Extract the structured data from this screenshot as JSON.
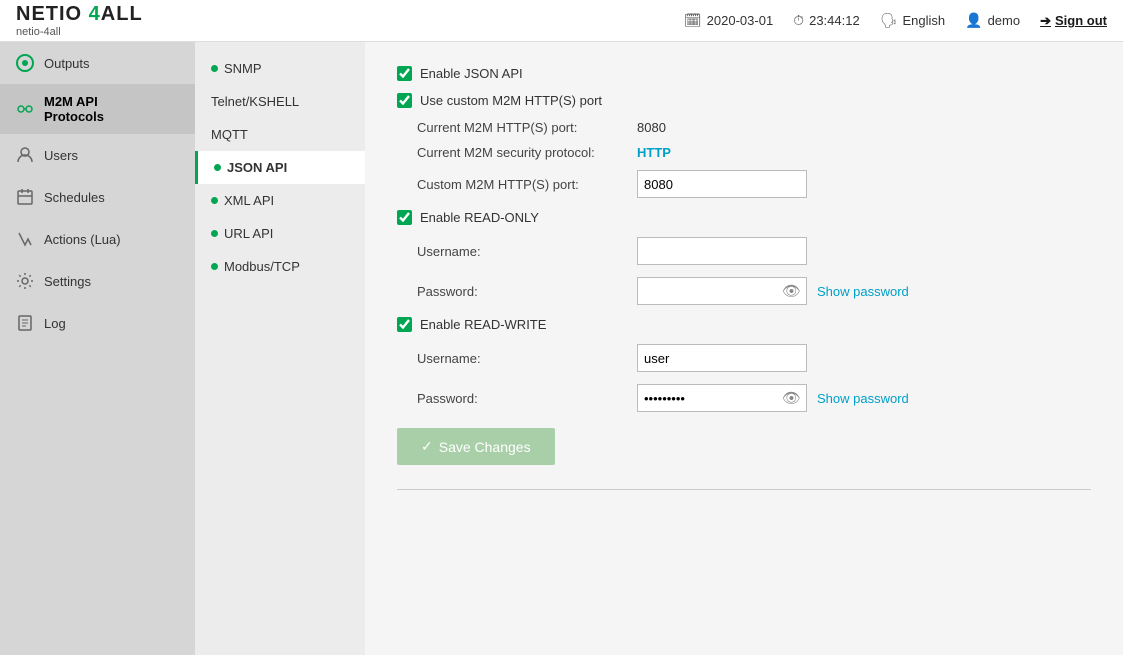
{
  "topbar": {
    "logo": "NETIO 4ALL",
    "subtitle": "netio-4all",
    "date": "2020-03-01",
    "time": "23:44:12",
    "language": "English",
    "user": "demo",
    "signout_label": "Sign out"
  },
  "sidebar": {
    "items": [
      {
        "id": "outputs",
        "label": "Outputs",
        "icon": "outputs-icon"
      },
      {
        "id": "m2m-api",
        "label": "M2M API\nProtocols",
        "label_line1": "M2M API",
        "label_line2": "Protocols",
        "icon": "m2m-icon",
        "active": true
      },
      {
        "id": "users",
        "label": "Users",
        "icon": "users-icon"
      },
      {
        "id": "schedules",
        "label": "Schedules",
        "icon": "schedules-icon"
      },
      {
        "id": "actions",
        "label": "Actions (Lua)",
        "icon": "actions-icon"
      },
      {
        "id": "settings",
        "label": "Settings",
        "icon": "settings-icon"
      },
      {
        "id": "log",
        "label": "Log",
        "icon": "log-icon"
      }
    ]
  },
  "sub_sidebar": {
    "items": [
      {
        "id": "snmp",
        "label": "SNMP",
        "dot": true
      },
      {
        "id": "telnet",
        "label": "Telnet/KSHELL",
        "dot": false
      },
      {
        "id": "mqtt",
        "label": "MQTT",
        "dot": false
      },
      {
        "id": "json-api",
        "label": "JSON API",
        "dot": true,
        "active": true
      },
      {
        "id": "xml-api",
        "label": "XML API",
        "dot": true
      },
      {
        "id": "url-api",
        "label": "URL API",
        "dot": true
      },
      {
        "id": "modbus",
        "label": "Modbus/TCP",
        "dot": true
      }
    ]
  },
  "content": {
    "enable_json_api_label": "Enable JSON API",
    "use_custom_port_label": "Use custom M2M HTTP(S) port",
    "current_port_label": "Current M2M HTTP(S) port:",
    "current_port_value": "8080",
    "current_security_label": "Current M2M security protocol:",
    "current_security_value": "HTTP",
    "custom_port_label": "Custom M2M HTTP(S) port:",
    "custom_port_value": "8080",
    "enable_read_only_label": "Enable READ-ONLY",
    "readonly_username_label": "Username:",
    "readonly_username_value": "",
    "readonly_password_label": "Password:",
    "readonly_password_value": "",
    "show_password_label_1": "Show password",
    "enable_read_write_label": "Enable READ-WRITE",
    "readwrite_username_label": "Username:",
    "readwrite_username_value": "user",
    "readwrite_password_label": "Password:",
    "readwrite_password_value": "••••••••",
    "show_password_label_2": "Show password",
    "save_button_label": "Save Changes"
  }
}
